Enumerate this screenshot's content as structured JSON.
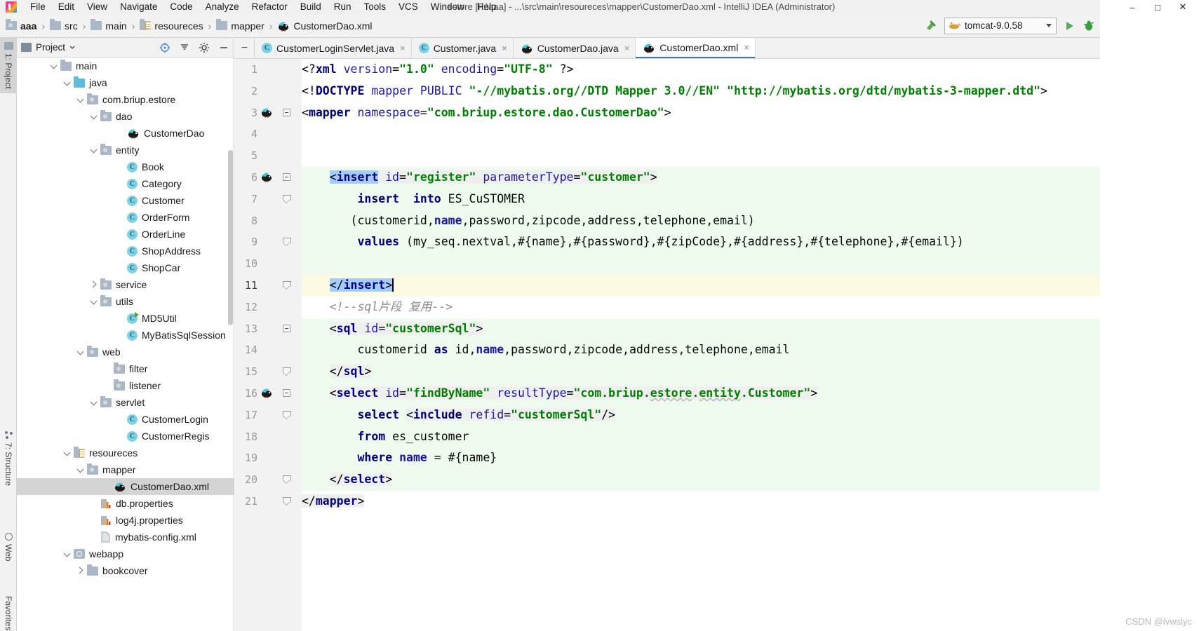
{
  "window": {
    "title": "estore [F:\\aaa] - ...\\src\\main\\resoureces\\mapper\\CustomerDao.xml - IntelliJ IDEA (Administrator)"
  },
  "menubar": {
    "items": [
      "File",
      "Edit",
      "View",
      "Navigate",
      "Code",
      "Analyze",
      "Refactor",
      "Build",
      "Run",
      "Tools",
      "VCS",
      "Window",
      "Help"
    ]
  },
  "breadcrumb": {
    "items": [
      {
        "label": "aaa",
        "icon": "folder-src-icon",
        "bold": true
      },
      {
        "label": "src",
        "icon": "folder-icon",
        "bold": false
      },
      {
        "label": "main",
        "icon": "folder-icon",
        "bold": false
      },
      {
        "label": "resoureces",
        "icon": "folder-resources-icon",
        "bold": false
      },
      {
        "label": "mapper",
        "icon": "folder-icon",
        "bold": false
      },
      {
        "label": "CustomerDao.xml",
        "icon": "mybatis-icon",
        "bold": false
      }
    ],
    "separator": "›"
  },
  "toolbar": {
    "build_icon": "hammer-icon",
    "run_config": "tomcat-9.0.58",
    "run_config_icon": "tomcat-cat-icon",
    "run_button": "run-icon",
    "debug_button": "debug-icon",
    "dropdown_arrow": "chevron-down-icon"
  },
  "tool_strip": {
    "left_buttons": [
      "1: Project",
      "7: Structure",
      "Web",
      "Favorites"
    ]
  },
  "project_panel": {
    "title": "Project",
    "title_chevron": "chevron-down-icon",
    "header_icons": [
      "target-icon",
      "collapse-all-icon",
      "settings-gear-icon",
      "hide-icon"
    ],
    "tree": [
      {
        "label": "main",
        "indent": 2,
        "twisty": "open",
        "icon": "folder-icon",
        "selected": false
      },
      {
        "label": "java",
        "indent": 3,
        "twisty": "open",
        "icon": "folder-source-icon",
        "selected": false
      },
      {
        "label": "com.briup.estore",
        "indent": 4,
        "twisty": "open",
        "icon": "package-icon",
        "selected": false
      },
      {
        "label": "dao",
        "indent": 5,
        "twisty": "open",
        "icon": "package-icon",
        "selected": false
      },
      {
        "label": "CustomerDao",
        "indent": 7,
        "twisty": "none",
        "icon": "mybatis-icon",
        "selected": false
      },
      {
        "label": "entity",
        "indent": 5,
        "twisty": "open",
        "icon": "package-icon",
        "selected": false
      },
      {
        "label": "Book",
        "indent": 7,
        "twisty": "none",
        "icon": "java-class-icon",
        "selected": false
      },
      {
        "label": "Category",
        "indent": 7,
        "twisty": "none",
        "icon": "java-class-icon",
        "selected": false
      },
      {
        "label": "Customer",
        "indent": 7,
        "twisty": "none",
        "icon": "java-class-icon",
        "selected": false
      },
      {
        "label": "OrderForm",
        "indent": 7,
        "twisty": "none",
        "icon": "java-class-icon",
        "selected": false
      },
      {
        "label": "OrderLine",
        "indent": 7,
        "twisty": "none",
        "icon": "java-class-icon",
        "selected": false
      },
      {
        "label": "ShopAddress",
        "indent": 7,
        "twisty": "none",
        "icon": "java-class-icon",
        "selected": false
      },
      {
        "label": "ShopCar",
        "indent": 7,
        "twisty": "none",
        "icon": "java-class-icon",
        "selected": false
      },
      {
        "label": "service",
        "indent": 5,
        "twisty": "closed",
        "icon": "package-icon",
        "selected": false
      },
      {
        "label": "utils",
        "indent": 5,
        "twisty": "open",
        "icon": "package-icon",
        "selected": false
      },
      {
        "label": "MD5Util",
        "indent": 7,
        "twisty": "none",
        "icon": "java-class-runnable-icon",
        "selected": false
      },
      {
        "label": "MyBatisSqlSession",
        "indent": 7,
        "twisty": "none",
        "icon": "java-class-icon",
        "selected": false
      },
      {
        "label": "web",
        "indent": 4,
        "twisty": "open",
        "icon": "package-icon",
        "selected": false
      },
      {
        "label": "filter",
        "indent": 6,
        "twisty": "none",
        "icon": "package-icon",
        "selected": false
      },
      {
        "label": "listener",
        "indent": 6,
        "twisty": "none",
        "icon": "package-icon",
        "selected": false
      },
      {
        "label": "servlet",
        "indent": 5,
        "twisty": "open",
        "icon": "package-icon",
        "selected": false
      },
      {
        "label": "CustomerLogin",
        "indent": 7,
        "twisty": "none",
        "icon": "java-class-icon",
        "selected": false
      },
      {
        "label": "CustomerRegis",
        "indent": 7,
        "twisty": "none",
        "icon": "java-class-icon",
        "selected": false
      },
      {
        "label": "resoureces",
        "indent": 3,
        "twisty": "open",
        "icon": "folder-resources-icon",
        "selected": false
      },
      {
        "label": "mapper",
        "indent": 4,
        "twisty": "open",
        "icon": "package-icon",
        "selected": false
      },
      {
        "label": "CustomerDao.xml",
        "indent": 6,
        "twisty": "none",
        "icon": "mybatis-icon",
        "selected": true
      },
      {
        "label": "db.properties",
        "indent": 5,
        "twisty": "none",
        "icon": "properties-icon",
        "selected": false
      },
      {
        "label": "log4j.properties",
        "indent": 5,
        "twisty": "none",
        "icon": "properties-icon",
        "selected": false
      },
      {
        "label": "mybatis-config.xml",
        "indent": 5,
        "twisty": "none",
        "icon": "xml-icon",
        "selected": false
      },
      {
        "label": "webapp",
        "indent": 3,
        "twisty": "open",
        "icon": "webapp-icon",
        "selected": false
      },
      {
        "label": "bookcover",
        "indent": 4,
        "twisty": "closed",
        "icon": "folder-icon",
        "selected": false
      }
    ]
  },
  "editor": {
    "collapse_icon": "minus-icon",
    "tabs": [
      {
        "label": "CustomerLoginServlet.java",
        "icon": "java-class-icon",
        "active": false,
        "close": "×"
      },
      {
        "label": "Customer.java",
        "icon": "java-class-icon",
        "active": false,
        "close": "×"
      },
      {
        "label": "CustomerDao.java",
        "icon": "mybatis-icon",
        "active": false,
        "close": "×"
      },
      {
        "label": "CustomerDao.xml",
        "icon": "mybatis-icon",
        "active": true,
        "close": "×"
      }
    ],
    "lines": [
      {
        "num": "1",
        "band": "none",
        "fold": "none",
        "mybatis": false
      },
      {
        "num": "2",
        "band": "none",
        "fold": "none",
        "mybatis": false
      },
      {
        "num": "3",
        "band": "none",
        "fold": "minus",
        "mybatis": true
      },
      {
        "num": "4",
        "band": "none",
        "fold": "none",
        "mybatis": false
      },
      {
        "num": "5",
        "band": "none",
        "fold": "none",
        "mybatis": false
      },
      {
        "num": "6",
        "band": "green",
        "fold": "minus",
        "mybatis": true
      },
      {
        "num": "7",
        "band": "green",
        "fold": "tri",
        "mybatis": false
      },
      {
        "num": "8",
        "band": "green",
        "fold": "none",
        "mybatis": false
      },
      {
        "num": "9",
        "band": "green",
        "fold": "tri",
        "mybatis": false
      },
      {
        "num": "10",
        "band": "green",
        "fold": "none",
        "mybatis": false
      },
      {
        "num": "11",
        "band": "yellow",
        "fold": "tri",
        "mybatis": false
      },
      {
        "num": "12",
        "band": "none",
        "fold": "none",
        "mybatis": false
      },
      {
        "num": "13",
        "band": "green",
        "fold": "minus",
        "mybatis": false
      },
      {
        "num": "14",
        "band": "green",
        "fold": "none",
        "mybatis": false
      },
      {
        "num": "15",
        "band": "green",
        "fold": "tri",
        "mybatis": false
      },
      {
        "num": "16",
        "band": "green",
        "fold": "minus",
        "mybatis": true
      },
      {
        "num": "17",
        "band": "green",
        "fold": "tri",
        "mybatis": false
      },
      {
        "num": "18",
        "band": "green",
        "fold": "none",
        "mybatis": false
      },
      {
        "num": "19",
        "band": "green",
        "fold": "none",
        "mybatis": false
      },
      {
        "num": "20",
        "band": "green",
        "fold": "tri",
        "mybatis": false
      },
      {
        "num": "21",
        "band": "none",
        "fold": "tri",
        "mybatis": false
      }
    ],
    "source_text": [
      "<?xml version=\"1.0\" encoding=\"UTF-8\" ?>",
      "<!DOCTYPE mapper PUBLIC \"-//mybatis.org//DTD Mapper 3.0//EN\" \"http://mybatis.org/dtd/mybatis-3-mapper.dtd\">",
      "<mapper namespace=\"com.briup.estore.dao.CustomerDao\">",
      "",
      "",
      "    <insert id=\"register\" parameterType=\"customer\">",
      "        insert  into ES_CuSTOMER",
      "       (customerid,name,password,zipcode,address,telephone,email)",
      "        values (my_seq.nextval,#{name},#{password},#{zipCode},#{address},#{telephone},#{email})",
      "",
      "    </insert>",
      "    <!--sql片段 复用-->",
      "    <sql id=\"customerSql\">",
      "        customerid as id,name,password,zipcode,address,telephone,email",
      "    </sql>",
      "    <select id=\"findByName\" resultType=\"com.briup.estore.entity.Customer\">",
      "        select <include refid=\"customerSql\"/>",
      "        from es_customer",
      "        where name = #{name}",
      "    </select>",
      "</mapper>"
    ],
    "inspection_widget": {
      "icons": [
        "inspection-circle-icon",
        "document-icon"
      ]
    }
  },
  "watermark": {
    "text": "CSDN @ivwslyc"
  }
}
